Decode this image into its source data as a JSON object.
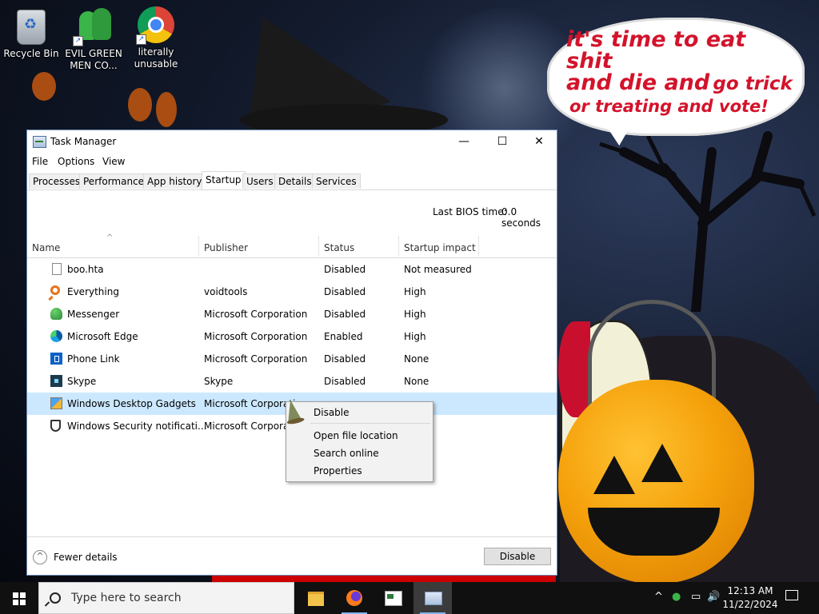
{
  "desktop": {
    "icons": [
      {
        "label": "Recycle Bin"
      },
      {
        "label": "EVIL GREEN MEN CO..."
      },
      {
        "label": "literally unusable"
      }
    ],
    "speech_bubble": {
      "line1": "it's time to eat shit",
      "line2a": "and die and",
      "line2b": "go trick",
      "line3": "or treating and vote!",
      "color": "#d3132b"
    }
  },
  "window": {
    "title": "Task Manager",
    "controls": {
      "minimize": "—",
      "maximize": "☐",
      "close": "✕"
    },
    "menu": [
      "File",
      "Options",
      "View"
    ],
    "tabs": [
      "Processes",
      "Performance",
      "App history",
      "Startup",
      "Users",
      "Details",
      "Services"
    ],
    "active_tab": "Startup",
    "bios_label": "Last BIOS time:",
    "bios_value": "0.0 seconds",
    "columns": [
      "Name",
      "Publisher",
      "Status",
      "Startup impact"
    ],
    "rows": [
      {
        "icon": "file-icon",
        "name": "boo.hta",
        "publisher": "",
        "status": "Disabled",
        "impact": "Not measured"
      },
      {
        "icon": "everything-icon",
        "name": "Everything",
        "publisher": "voidtools",
        "status": "Disabled",
        "impact": "High"
      },
      {
        "icon": "messenger-icon",
        "name": "Messenger",
        "publisher": "Microsoft Corporation",
        "status": "Disabled",
        "impact": "High"
      },
      {
        "icon": "edge-icon",
        "name": "Microsoft Edge",
        "publisher": "Microsoft Corporation",
        "status": "Enabled",
        "impact": "High"
      },
      {
        "icon": "phone-link-icon",
        "name": "Phone Link",
        "publisher": "Microsoft Corporation",
        "status": "Disabled",
        "impact": "None"
      },
      {
        "icon": "skype-icon",
        "name": "Skype",
        "publisher": "Skype",
        "status": "Disabled",
        "impact": "None"
      },
      {
        "icon": "gadgets-icon",
        "name": "Windows Desktop Gadgets",
        "publisher": "Microsoft Corporati",
        "status": "",
        "impact": ""
      },
      {
        "icon": "shield-icon",
        "name": "Windows Security notificati...",
        "publisher": "Microsoft Corporati",
        "status": "",
        "impact": ""
      }
    ],
    "selected_row": 6,
    "context_menu": [
      "Disable",
      "Open file location",
      "Search online",
      "Properties"
    ],
    "footer": {
      "fewer_details": "Fewer details",
      "disable_button": "Disable"
    }
  },
  "taskbar": {
    "search_placeholder": "Type here to search",
    "apps": [
      "file-explorer-icon",
      "firefox-icon",
      "news-icon",
      "task-manager-icon"
    ],
    "tray": {
      "chevron": "^",
      "volume": "🔊"
    },
    "clock": {
      "time": "12:13 AM",
      "date": "11/22/2024"
    }
  }
}
